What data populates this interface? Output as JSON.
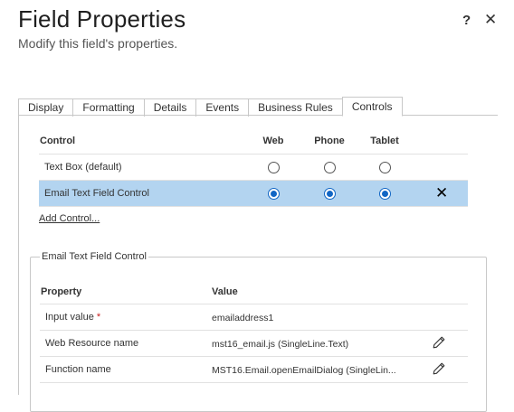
{
  "header": {
    "title": "Field Properties",
    "subtitle": "Modify this field's properties.",
    "help_label": "?",
    "close_label": "✕"
  },
  "tabs": [
    {
      "label": "Display",
      "active": false
    },
    {
      "label": "Formatting",
      "active": false
    },
    {
      "label": "Details",
      "active": false
    },
    {
      "label": "Events",
      "active": false
    },
    {
      "label": "Business Rules",
      "active": false
    },
    {
      "label": "Controls",
      "active": true
    }
  ],
  "controls": {
    "headers": {
      "control": "Control",
      "web": "Web",
      "phone": "Phone",
      "tablet": "Tablet"
    },
    "rows": [
      {
        "name": "Text Box (default)",
        "web": false,
        "phone": false,
        "tablet": false,
        "selected": false
      },
      {
        "name": "Email Text Field Control",
        "web": true,
        "phone": true,
        "tablet": true,
        "selected": true
      }
    ],
    "remove_icon": "close-icon",
    "add_link": "Add Control..."
  },
  "properties": {
    "legend": "Email Text Field Control",
    "headers": {
      "property": "Property",
      "value": "Value"
    },
    "rows": [
      {
        "name": "Input value",
        "required_mark": "*",
        "value": "emailaddress1",
        "editable": false
      },
      {
        "name": "Web Resource name",
        "required_mark": "",
        "value": "mst16_email.js (SingleLine.Text)",
        "editable": true
      },
      {
        "name": "Function name",
        "required_mark": "",
        "value": "MST16.Email.openEmailDialog (SingleLin...",
        "editable": true
      }
    ],
    "edit_icon": "pencil-icon"
  },
  "colors": {
    "selected_row": "#b3d4f0",
    "radio_checked": "#1266c4",
    "required": "#c81e1e"
  }
}
